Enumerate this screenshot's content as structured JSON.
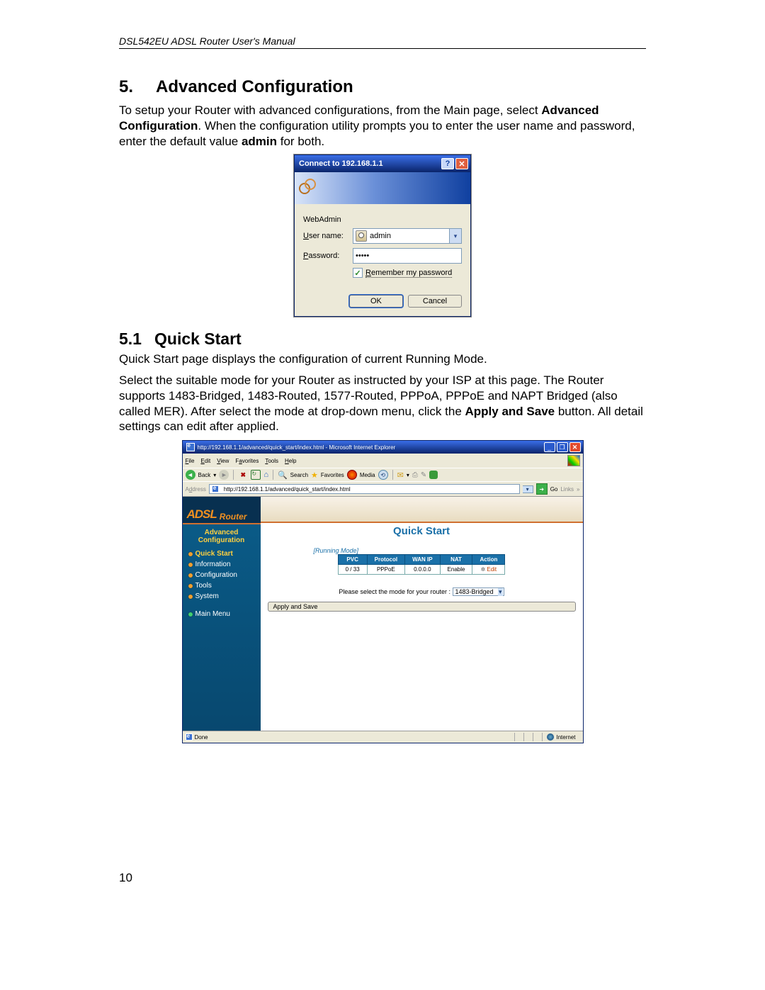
{
  "header": "DSL542EU ADSL Router User's Manual",
  "section5": {
    "num": "5.",
    "title": "Advanced Configuration",
    "para_pre": "To setup your Router with advanced configurations, from the Main page, select ",
    "para_bold": "Advanced Configuration",
    "para_mid": ". When the configuration utility prompts you to enter the user name and password, enter the default value ",
    "para_bold2": "admin",
    "para_post": " for both."
  },
  "login": {
    "title": "Connect to 192.168.1.1",
    "realm": "WebAdmin",
    "user_label": "User name:",
    "pass_label": "Password:",
    "user_value": "admin",
    "pass_value": "•••••",
    "remember": "Remember my password",
    "ok": "OK",
    "cancel": "Cancel"
  },
  "section51": {
    "num": "5.1",
    "title": "Quick Start",
    "p1": "Quick Start page displays the configuration of current Running Mode.",
    "p2a": "Select the suitable mode for your Router as instructed by your ISP at this page. The Router supports 1483-Bridged, 1483-Routed, 1577-Routed, PPPoA, PPPoE and NAPT Bridged (also called MER). After select the mode at drop-down menu, click the ",
    "p2bold": "Apply and Save",
    "p2b": " button. All detail settings can edit after applied."
  },
  "ie": {
    "title": "http://192.168.1.1/advanced/quick_start/index.html - Microsoft Internet Explorer",
    "menu": {
      "file": "File",
      "edit": "Edit",
      "view": "View",
      "fav": "Favorites",
      "tools": "Tools",
      "help": "Help"
    },
    "tb": {
      "back": "Back",
      "search": "Search",
      "favorites": "Favorites",
      "media": "Media"
    },
    "addr_label": "Address",
    "addr_value": "http://192.168.1.1/advanced/quick_start/index.html",
    "go": "Go",
    "links": "Links",
    "brand_a": "ADSL",
    "brand_r": "Router",
    "sidebar_title": "Advanced Configuration",
    "nav": [
      {
        "label": "Quick Start",
        "active": true
      },
      {
        "label": "Information"
      },
      {
        "label": "Configuration"
      },
      {
        "label": "Tools"
      },
      {
        "label": "System"
      }
    ],
    "main_menu": "Main Menu",
    "qs_title": "Quick Start",
    "running_mode": "[Running Mode]",
    "table": {
      "headers": {
        "pvc": "PVC",
        "proto": "Protocol",
        "wan": "WAN IP",
        "nat": "NAT",
        "action": "Action"
      },
      "row": {
        "pvc": "0 / 33",
        "proto": "PPPoE",
        "wan": "0.0.0.0",
        "nat": "Enable",
        "action": "Edit"
      }
    },
    "mode_label": "Please select the mode for your router :",
    "mode_value": "1483-Bridged",
    "apply": "Apply and Save",
    "status_done": "Done",
    "status_zone": "Internet"
  },
  "page_number": "10"
}
